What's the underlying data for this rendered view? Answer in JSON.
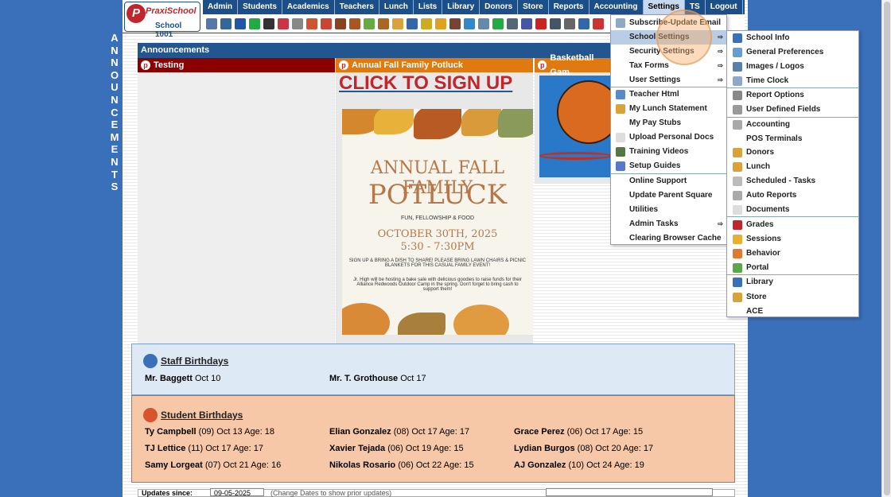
{
  "announce_vertical": "ANNOUNCEMENTS",
  "logo": {
    "brand": "PraxiSchool",
    "school": "School 1001"
  },
  "menu": [
    "Admin",
    "Students",
    "Academics",
    "Teachers",
    "Lunch",
    "Lists",
    "Library",
    "Donors",
    "Store",
    "Reports",
    "Accounting",
    "Settings",
    "TS",
    "Logout"
  ],
  "toolbar_icons": [
    "search-icon",
    "calendar-icon",
    "at-icon",
    "chat-icon",
    "phone-icon",
    "flag-icon",
    "list-icon",
    "date-icon",
    "megaphone-icon",
    "people-icon",
    "people2-icon",
    "pencil-icon",
    "group-icon",
    "money-icon",
    "book-icon",
    "bell-icon",
    "note-icon",
    "users-icon",
    "clock-icon",
    "doc-icon",
    "cash-icon",
    "printer-icon",
    "ap-icon",
    "pdf-icon",
    "print-icon",
    "gear-icon",
    "help-icon",
    "power-icon"
  ],
  "announcements": {
    "header": "Announcements",
    "col1": "Testing",
    "col2": "Annual Fall Family Potluck",
    "col3": "Basketball Gam",
    "click_sign_up": "CLICK TO SIGN UP",
    "flyer": {
      "line1": "ANNUAL FALL FAMILY",
      "line2": "POTLUCK",
      "tagline": "FUN, FELLOWSHIP & FOOD",
      "date": "OCTOBER 30TH, 2025",
      "time": "5:30 - 7:30PM",
      "note1": "SIGN UP & BRING A DISH TO SHARE! PLEASE BRING LAWN CHAIRS & PICNIC BLANKETS FOR THIS CASUAL FAMILY EVENT!",
      "note2": "Jr. High will be hosting a bake sale with delicious goodies to raise funds for their Alliance Redwoods Outdoor Camp in the spring. Don't forget to bring cash to support them!"
    }
  },
  "staff_birthdays": {
    "title": "Staff Birthdays",
    "items": [
      {
        "name": "Mr. Baggett",
        "date": "Oct 10"
      },
      {
        "name": "Mr. T. Grothouse",
        "date": "Oct 17"
      }
    ]
  },
  "student_birthdays": {
    "title": "Student Birthdays",
    "items": [
      {
        "name": "Ty Campbell",
        "info": "(09) Oct 13 Age: 18"
      },
      {
        "name": "Elian Gonzalez",
        "info": "(08) Oct 17 Age: 17"
      },
      {
        "name": "Grace Perez",
        "info": "(06) Oct 17 Age: 15"
      },
      {
        "name": "TJ Lettice",
        "info": "(11) Oct 17 Age: 17"
      },
      {
        "name": "Xavier Tejada",
        "info": "(06) Oct 19 Age: 15"
      },
      {
        "name": "Lydian Burgos",
        "info": "(08) Oct 20 Age: 17"
      },
      {
        "name": "Samy Lorgeat",
        "info": "(07) Oct 21 Age: 16"
      },
      {
        "name": "Nikolas Rosario",
        "info": "(06) Oct 22 Age: 15"
      },
      {
        "name": "AJ Gonzalez",
        "info": "(10) Oct 24 Age: 19"
      }
    ]
  },
  "bottom": {
    "label": "Updates since:",
    "date": "09-05-2025",
    "hint": "(Change Dates to show prior updates)"
  },
  "settings_menu": [
    {
      "label": "Subscribe-Update Email",
      "icon": "email-icon",
      "arrow": false
    },
    {
      "label": "School Settings",
      "icon": "",
      "arrow": true,
      "highlight": true
    },
    {
      "label": "Security Settings",
      "icon": "",
      "arrow": true
    },
    {
      "label": "Tax Forms",
      "icon": "",
      "arrow": true
    },
    {
      "label": "User Settings",
      "icon": "",
      "arrow": true
    },
    {
      "label": "Teacher Html",
      "icon": "teacher-icon",
      "arrow": false
    },
    {
      "label": "My Lunch Statement",
      "icon": "lunch-icon",
      "arrow": false
    },
    {
      "label": "My Pay Stubs",
      "icon": "",
      "arrow": false
    },
    {
      "label": "Upload Personal Docs",
      "icon": "doc-icon",
      "arrow": false
    },
    {
      "label": "Training Videos",
      "icon": "film-icon",
      "arrow": false
    },
    {
      "label": "Setup Guides",
      "icon": "help-icon",
      "arrow": false
    },
    {
      "label": "Online Support",
      "icon": "",
      "arrow": false
    },
    {
      "label": "Update Parent Square",
      "icon": "",
      "arrow": false
    },
    {
      "label": "Utilities",
      "icon": "",
      "arrow": false
    },
    {
      "label": "Admin Tasks",
      "icon": "",
      "arrow": true
    },
    {
      "label": "Clearing Browser Cache",
      "icon": "",
      "arrow": false
    }
  ],
  "school_settings_submenu": [
    {
      "label": "School Info",
      "icon": "person-icon",
      "color": "#3a6fba"
    },
    {
      "label": "General Preferences",
      "icon": "prefs-icon",
      "color": "#6a9bd0"
    },
    {
      "label": "Images / Logos",
      "icon": "image-icon",
      "color": "#5b7fa8"
    },
    {
      "label": "Time Clock",
      "icon": "clock-icon",
      "color": "#8fa8c8"
    },
    {
      "label": "Report Options",
      "icon": "printer-icon",
      "color": "#888"
    },
    {
      "label": "User Defined Fields",
      "icon": "gear-icon",
      "color": "#999"
    },
    {
      "label": "Accounting",
      "icon": "gear-icon",
      "color": "#aaa"
    },
    {
      "label": "POS Terminals",
      "icon": "",
      "color": ""
    },
    {
      "label": "Donors",
      "icon": "donor-icon",
      "color": "#d9a33c"
    },
    {
      "label": "Lunch",
      "icon": "lunch-icon",
      "color": "#d9a33c"
    },
    {
      "label": "Scheduled - Tasks",
      "icon": "task-icon",
      "color": "#bbb"
    },
    {
      "label": "Auto Reports",
      "icon": "report-icon",
      "color": "#aaa"
    },
    {
      "label": "Documents",
      "icon": "doc-icon",
      "color": "#ddd"
    },
    {
      "label": "Grades",
      "icon": "grade-icon",
      "color": "#c0262c"
    },
    {
      "label": "Sessions",
      "icon": "sessions-icon",
      "color": "#e8b030"
    },
    {
      "label": "Behavior",
      "icon": "behavior-icon",
      "color": "#e07a30"
    },
    {
      "label": "Portal",
      "icon": "portal-icon",
      "color": "#5aa84a"
    },
    {
      "label": "Library",
      "icon": "library-icon",
      "color": "#3a6fba"
    },
    {
      "label": "Store",
      "icon": "store-icon",
      "color": "#d9a33c"
    },
    {
      "label": "ACE",
      "icon": "",
      "color": ""
    }
  ]
}
